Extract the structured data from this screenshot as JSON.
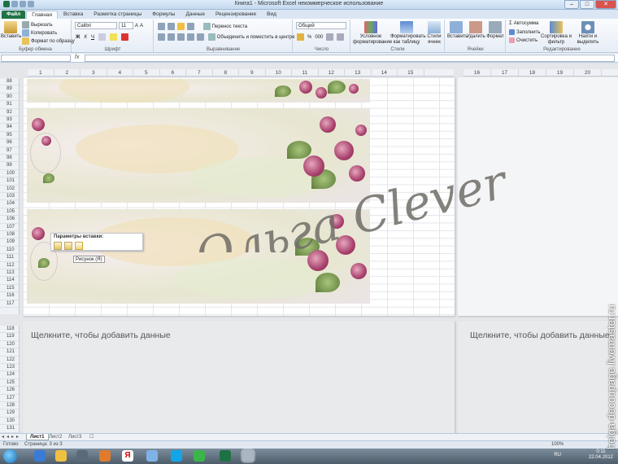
{
  "window": {
    "title": "Книга1 - Microsoft Excel некоммерческое использование",
    "min": "–",
    "max": "□",
    "close": "✕"
  },
  "tabs": [
    "Файл",
    "Главная",
    "Вставка",
    "Разметка страницы",
    "Формулы",
    "Данные",
    "Рецензирование",
    "Вид"
  ],
  "ribbon": {
    "clipboard": {
      "label": "Буфер обмена",
      "paste": "Вставить",
      "cut": "Вырезать",
      "copy": "Копировать",
      "format_painter": "Формат по образцу"
    },
    "font": {
      "label": "Шрифт",
      "name": "Calibri",
      "size": "11",
      "bold": "Ж",
      "italic": "К",
      "underline": "Ч"
    },
    "alignment": {
      "label": "Выравнивание",
      "wrap": "Перенос текста",
      "merge": "Объединить и поместить в центре"
    },
    "number": {
      "label": "Число",
      "format": "Общий",
      "percent": "%",
      "thousands": "000"
    },
    "styles": {
      "label": "Стили",
      "conditional": "Условное форматирование",
      "as_table": "Форматировать как таблицу",
      "cell_styles": "Стили ячеек"
    },
    "cells": {
      "label": "Ячейки",
      "insert": "Вставить",
      "delete": "Удалить",
      "format": "Формат"
    },
    "editing": {
      "label": "Редактирование",
      "autosum": "Автосумма",
      "fill": "Заполнить",
      "clear": "Очистить",
      "sort": "Сортировка и фильтр",
      "find": "Найти и выделить"
    }
  },
  "formula_bar": {
    "fx": "fx",
    "name": "",
    "value": ""
  },
  "columns_left": [
    "1",
    "2",
    "3",
    "4",
    "5",
    "6",
    "7",
    "8",
    "9",
    "10",
    "11",
    "12",
    "13",
    "14",
    "15"
  ],
  "columns_right": [
    "16",
    "17",
    "18",
    "19",
    "20"
  ],
  "rows_top": [
    "88",
    "89",
    "90",
    "91",
    "92",
    "93",
    "94",
    "95",
    "96",
    "97",
    "98",
    "99",
    "100",
    "101",
    "102",
    "103",
    "104",
    "105",
    "106",
    "107",
    "108",
    "109",
    "110",
    "111",
    "112",
    "113",
    "114",
    "115",
    "116",
    "117"
  ],
  "rows_bottom": [
    "118",
    "119",
    "120",
    "121",
    "122",
    "123",
    "124",
    "125",
    "126",
    "127",
    "128",
    "129",
    "130",
    "131"
  ],
  "paste_options": {
    "title": "Параметры вставки:",
    "tooltip": "Рисунок (Я)"
  },
  "hints": {
    "left": "Щелкните, чтобы добавить данные",
    "right": "Щелкните, чтобы добавить данные"
  },
  "watermark": {
    "line1": "Ольга Clever"
  },
  "sheets": [
    "Лист1",
    "Лист2",
    "Лист3"
  ],
  "status": {
    "ready": "Готово",
    "page": "Страница: 3 из 3",
    "zoom": "100%"
  },
  "tray": {
    "lang": "RU",
    "time": "0:11",
    "date": "22.04.2012"
  },
  "side_watermark": "helga-decoupage.livemaster.ru"
}
